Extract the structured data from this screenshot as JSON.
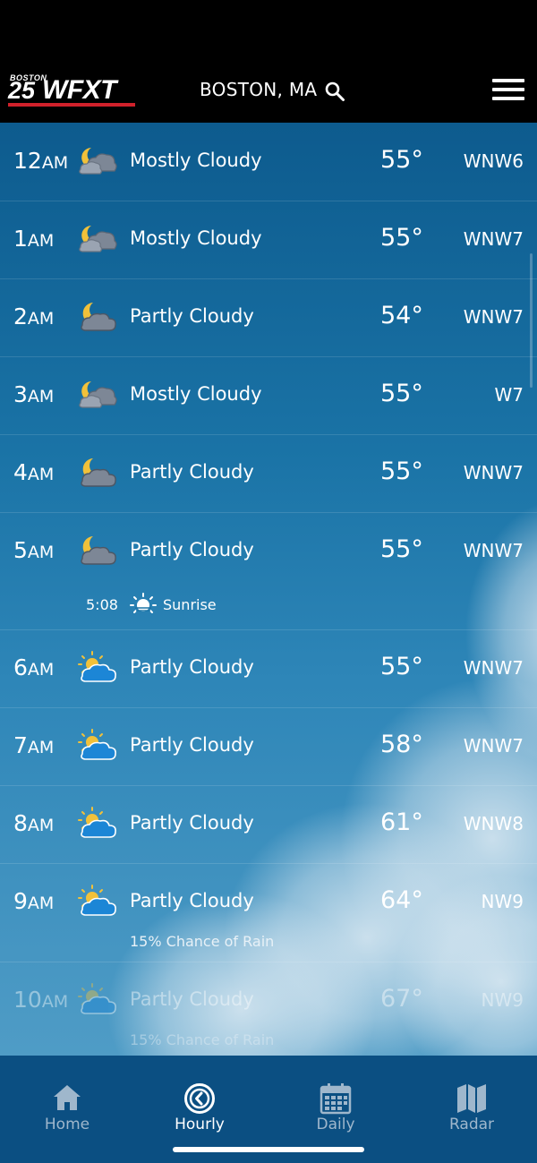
{
  "header": {
    "logo_top": "BOSTON",
    "logo_num": "25",
    "logo_word": "WFXT",
    "location": "BOSTON, MA"
  },
  "colors": {
    "accent_red": "#d0212b",
    "nav_bg": "#0b4f82",
    "sky_top": "#0d5b8e"
  },
  "hours": [
    {
      "hour": "12",
      "ampm": "AM",
      "icon": "moon-mostly-cloudy-icon",
      "condition": "Mostly Cloudy",
      "temp": "55°",
      "wind": "WNW6"
    },
    {
      "hour": "1",
      "ampm": "AM",
      "icon": "moon-mostly-cloudy-icon",
      "condition": "Mostly Cloudy",
      "temp": "55°",
      "wind": "WNW7"
    },
    {
      "hour": "2",
      "ampm": "AM",
      "icon": "moon-partly-cloudy-icon",
      "condition": "Partly Cloudy",
      "temp": "54°",
      "wind": "WNW7"
    },
    {
      "hour": "3",
      "ampm": "AM",
      "icon": "moon-mostly-cloudy-icon",
      "condition": "Mostly Cloudy",
      "temp": "55°",
      "wind": "W7"
    },
    {
      "hour": "4",
      "ampm": "AM",
      "icon": "moon-partly-cloudy-icon",
      "condition": "Partly Cloudy",
      "temp": "55°",
      "wind": "WNW7"
    },
    {
      "hour": "5",
      "ampm": "AM",
      "icon": "moon-partly-cloudy-icon",
      "condition": "Partly Cloudy",
      "temp": "55°",
      "wind": "WNW7",
      "sunrise_time": "5:08",
      "sunrise_label": "Sunrise"
    },
    {
      "hour": "6",
      "ampm": "AM",
      "icon": "sun-partly-cloudy-icon",
      "condition": "Partly Cloudy",
      "temp": "55°",
      "wind": "WNW7"
    },
    {
      "hour": "7",
      "ampm": "AM",
      "icon": "sun-partly-cloudy-icon",
      "condition": "Partly Cloudy",
      "temp": "58°",
      "wind": "WNW7"
    },
    {
      "hour": "8",
      "ampm": "AM",
      "icon": "sun-partly-cloudy-icon",
      "condition": "Partly Cloudy",
      "temp": "61°",
      "wind": "WNW8"
    },
    {
      "hour": "9",
      "ampm": "AM",
      "icon": "sun-partly-cloudy-icon",
      "condition": "Partly Cloudy",
      "temp": "64°",
      "wind": "NW9",
      "note": "15% Chance of Rain"
    },
    {
      "hour": "10",
      "ampm": "AM",
      "icon": "sun-partly-cloudy-icon",
      "condition": "Partly Cloudy",
      "temp": "67°",
      "wind": "NW9",
      "note": "15% Chance of Rain"
    }
  ],
  "nav": {
    "home": "Home",
    "hourly": "Hourly",
    "daily": "Daily",
    "radar": "Radar",
    "active": "Hourly"
  }
}
